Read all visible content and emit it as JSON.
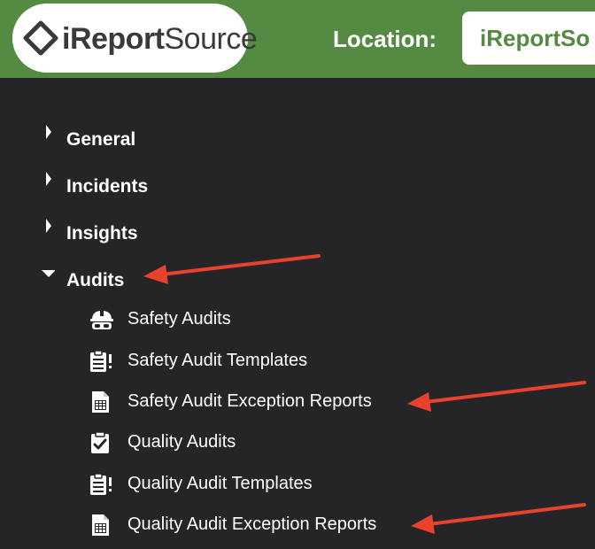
{
  "header": {
    "logo": {
      "brand_bold": "iReport",
      "brand_light": "Source"
    },
    "location_label": "Location:",
    "location_value": "iReportSo"
  },
  "menu": {
    "sections": [
      {
        "label": "General",
        "expanded": false
      },
      {
        "label": "Incidents",
        "expanded": false
      },
      {
        "label": "Insights",
        "expanded": false
      },
      {
        "label": "Audits",
        "expanded": true
      }
    ],
    "audit_items": [
      {
        "label": "Safety Audits",
        "icon": "hard-hat-icon"
      },
      {
        "label": "Safety Audit Templates",
        "icon": "clipboard-list-icon"
      },
      {
        "label": "Safety Audit Exception Reports",
        "icon": "spreadsheet-icon"
      },
      {
        "label": "Quality Audits",
        "icon": "clipboard-check-icon"
      },
      {
        "label": "Quality Audit Templates",
        "icon": "clipboard-list-icon"
      },
      {
        "label": "Quality Audit Exception Reports",
        "icon": "spreadsheet-icon"
      }
    ]
  },
  "colors": {
    "header_green": "#558a43",
    "sidebar_bg": "#252527",
    "annotation_red": "#e8412c"
  }
}
